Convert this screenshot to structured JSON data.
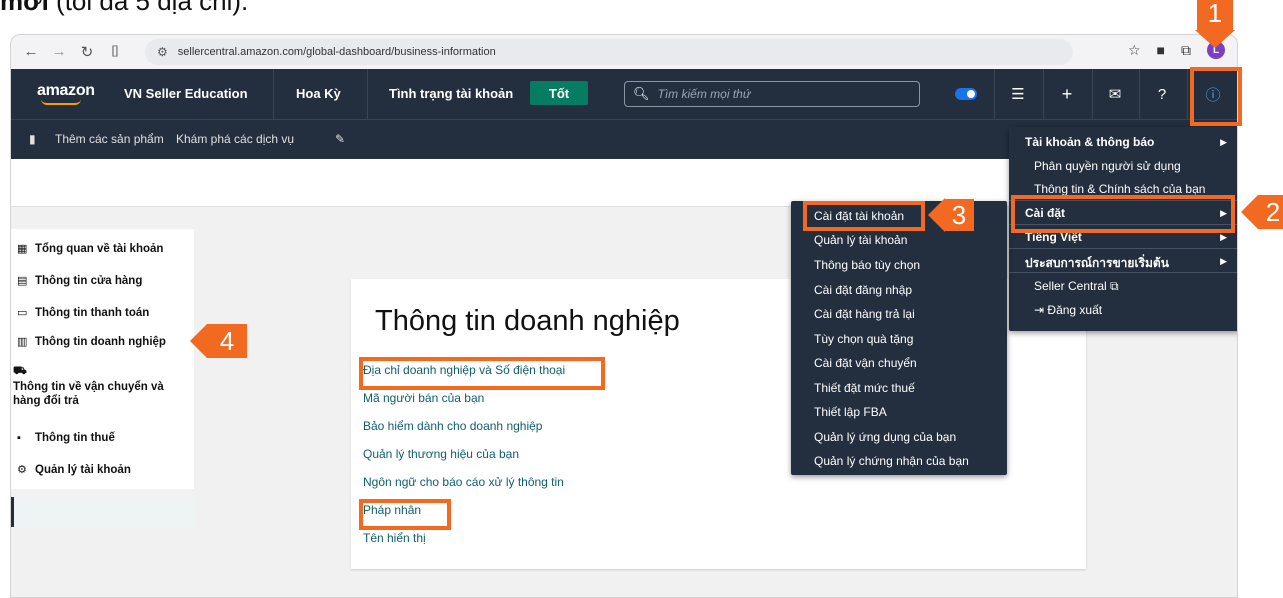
{
  "caption": {
    "bold": "mới",
    "rest": " (tối đa 5 địa chỉ)."
  },
  "browser": {
    "url": "sellercentral.amazon.com/global-dashboard/business-information",
    "avatar_letter": "L"
  },
  "topnav": {
    "logo": "amazon",
    "store": "VN Seller Education",
    "marketplace": "Hoa Kỳ",
    "account_health_label": "Tình trạng tài khoản",
    "account_health_status": "Tốt",
    "search_placeholder": "Tìm kiếm mọi thứ"
  },
  "subnav": {
    "add_products": "Thêm các sản phẩm",
    "explore_services": "Khám phá các dịch vụ"
  },
  "sidebar": {
    "items": [
      {
        "label": "Tổng quan về tài khoản"
      },
      {
        "label": "Thông tin cửa hàng"
      },
      {
        "label": "Thông tin thanh toán"
      },
      {
        "label": "Thông tin doanh nghiệp"
      },
      {
        "label": "Thông tin về vận chuyển và hàng đổi trả"
      },
      {
        "label": "Thông tin thuế"
      },
      {
        "label": "Quản lý tài khoản"
      }
    ]
  },
  "card": {
    "title": "Thông tin doanh nghiệp",
    "links": [
      "Địa chỉ doanh nghiệp và Số điện thoại",
      "Mã người bán của bạn",
      "Bảo hiểm dành cho doanh nghiệp",
      "Quản lý thương hiệu của bạn",
      "Ngôn ngữ cho báo cáo xử lý thông tin",
      "Pháp nhân",
      "Tên hiển thị"
    ]
  },
  "account_menu": {
    "section1": "Tài khoản & thông báo",
    "user_permissions": "Phân quyền người sử dụng",
    "info_policies": "Thông tin & Chính sách của bạn",
    "settings": "Cài đặt",
    "language": "Tiếng Việt",
    "thai": "ประสบการณ์การขายเริ่มต้น",
    "seller_central": "Seller Central",
    "logout": "Đăng xuất"
  },
  "settings_menu": {
    "items": [
      "Cài đặt tài khoản",
      "Quản lý tài khoản",
      "Thông báo tùy chọn",
      "Cài đặt đăng nhập",
      "Cài đặt hàng trả lại",
      "Tùy chọn quà tặng",
      "Cài đặt vận chuyển",
      "Thiết đặt mức thuế",
      "Thiết lập FBA",
      "Quản lý ứng dụng của bạn",
      "Quản lý chứng nhận của bạn"
    ]
  },
  "callouts": [
    "1",
    "2",
    "3",
    "4"
  ],
  "colors": {
    "accent": "#f26a21",
    "nav": "#232f3e",
    "ok": "#067d62",
    "link": "#0f5e6e"
  }
}
